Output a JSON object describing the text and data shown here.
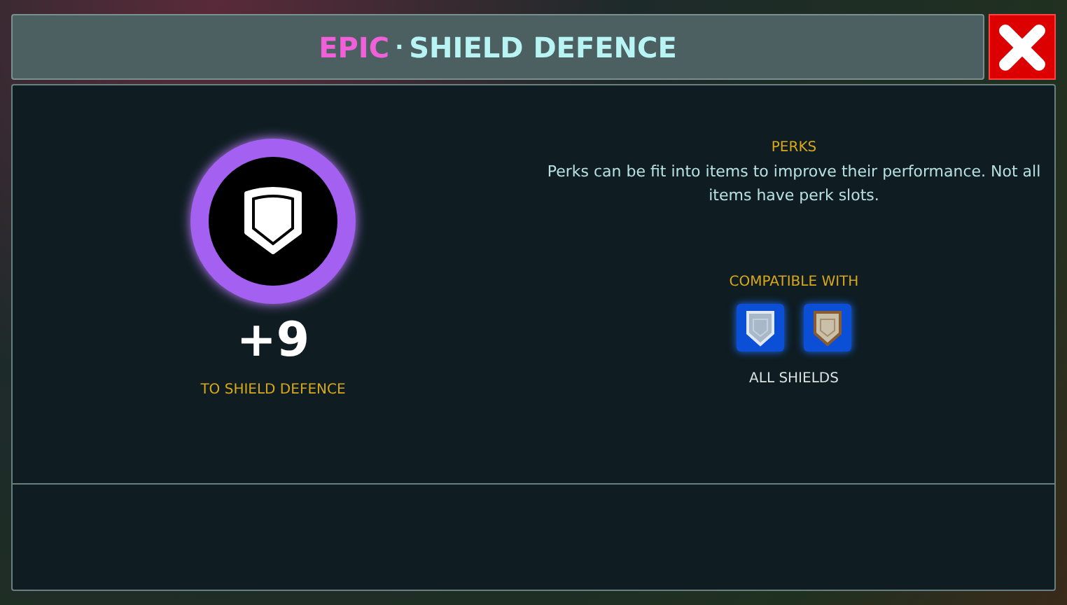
{
  "title": {
    "rarity": "EPIC",
    "separator": "·",
    "name": "SHIELD DEFENCE"
  },
  "stat": {
    "value": "+9",
    "label": "TO SHIELD DEFENCE"
  },
  "perks": {
    "heading": "PERKS",
    "description": "Perks can be fit into items to improve their performance. Not all items have perk slots."
  },
  "compatible": {
    "heading": "COMPATIBLE WITH",
    "label": "ALL SHIELDS"
  }
}
